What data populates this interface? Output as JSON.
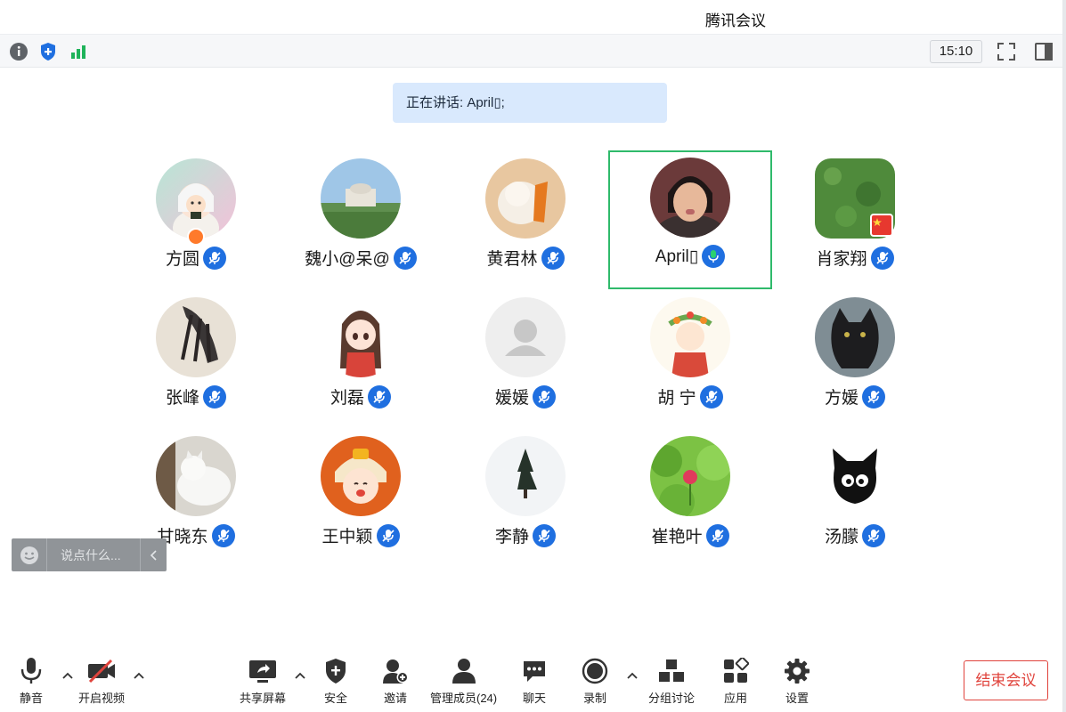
{
  "window": {
    "title": "腾讯会议"
  },
  "statusbar": {
    "clock": "15:10",
    "icons": [
      "info-icon",
      "shield-icon",
      "signal-icon",
      "fullscreen-icon",
      "side-panel-icon"
    ]
  },
  "speaking": {
    "text": "正在讲话: April▯;"
  },
  "participants": [
    {
      "name": "方圆",
      "mic": "muted-mic-icon"
    },
    {
      "name": "魏小@呆@",
      "mic": "muted-mic-icon"
    },
    {
      "name": "黄君林",
      "mic": "muted-mic-icon"
    },
    {
      "name": "April▯",
      "mic": "speaking-mic-icon",
      "active": true
    },
    {
      "name": "肖家翔",
      "mic": "muted-mic-icon"
    },
    {
      "name": "张峰",
      "mic": "muted-mic-icon"
    },
    {
      "name": "刘磊",
      "mic": "muted-mic-icon"
    },
    {
      "name": "媛媛",
      "mic": "muted-mic-icon"
    },
    {
      "name": "胡 宁",
      "mic": "muted-mic-icon"
    },
    {
      "name": "方媛",
      "mic": "muted-mic-icon"
    },
    {
      "name": "甘晓东",
      "mic": "muted-mic-icon"
    },
    {
      "name": "王中颖",
      "mic": "muted-mic-icon"
    },
    {
      "name": "李静",
      "mic": "muted-mic-icon"
    },
    {
      "name": "崔艳叶",
      "mic": "muted-mic-icon"
    },
    {
      "name": "汤朦",
      "mic": "muted-mic-icon"
    }
  ],
  "chat": {
    "placeholder": "说点什么..."
  },
  "toolbar": {
    "mute": "静音",
    "video": "开启视频",
    "share": "共享屏幕",
    "security": "安全",
    "invite": "邀请",
    "members": "管理成员(24)",
    "chat": "聊天",
    "record": "录制",
    "breakout": "分组讨论",
    "apps": "应用",
    "settings": "设置",
    "end": "结束会议"
  },
  "colors": {
    "accent": "#1f6fe0",
    "active_border": "#2fba6b",
    "end_red": "#e0433c",
    "banner": "#d9e9fd"
  }
}
